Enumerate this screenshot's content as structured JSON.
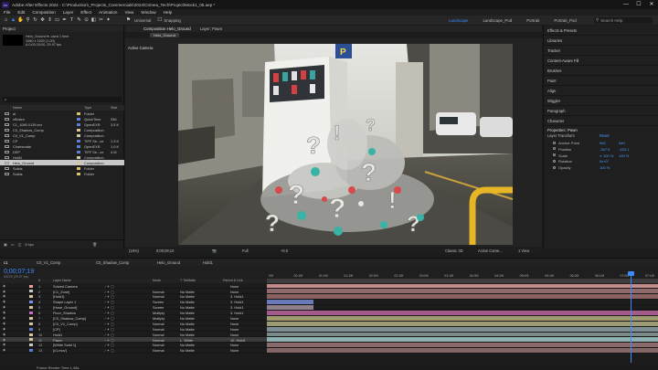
{
  "window": {
    "title": "Adobe After Effects 2024 - C:\\Production\\_Projects_Commercials\\2024\\Crimea_Tech\\Project\\Mock1_05.aep *",
    "app_icon": "Ae",
    "controls": [
      "—",
      "☐",
      "✕"
    ]
  },
  "menu": [
    "File",
    "Edit",
    "Composition",
    "Layer",
    "Effect",
    "Animation",
    "View",
    "Window",
    "Help"
  ],
  "toolbar": {
    "tools": [
      "home-icon",
      "selection-tool-icon",
      "hand-tool-icon",
      "zoom-tool-icon",
      "orbit-tool-icon",
      "pan-tool-icon",
      "dolly-tool-icon",
      "rect-tool-icon",
      "pen-tool-icon",
      "type-tool-icon",
      "brush-tool-icon",
      "clone-tool-icon",
      "eraser-tool-icon",
      "roto-tool-icon",
      "puppet-tool-icon"
    ],
    "snapping_label": "Snapping",
    "universal_label": "Universal",
    "workspaces": [
      "Landscape",
      "Landscape_Pod",
      "Portrait",
      "Portrait_Pod"
    ],
    "active_workspace": "Landscape",
    "search_placeholder": "Search Help"
  },
  "project": {
    "panel_title": "Project",
    "thumb_name": "Helo_Ground",
    "thumb_info": [
      "Helo_Ground ▾, used 1 time",
      "1080 x 1920 (1.00)",
      "Δ 0;00;10;00, 29.97 fps"
    ],
    "search_placeholder": "ρ",
    "columns": [
      "Name",
      "Type",
      "Size"
    ],
    "items": [
      {
        "name": "ai",
        "type": "Folder",
        "size": "",
        "label": "#d8c46a"
      },
      {
        "name": "cBoken",
        "type": "QuickTime",
        "size": "336",
        "label": "#5c7fd1"
      },
      {
        "name": "C1_1080.0139.exr",
        "type": "OpenEXR",
        "size": "3.5 K",
        "label": "#5c7fd1"
      },
      {
        "name": "C0_Shadow_Comp",
        "type": "Composition",
        "size": "",
        "label": "#d3c6a0"
      },
      {
        "name": "C0_V1_Comp",
        "type": "Composition",
        "size": "",
        "label": "#d3c6a0"
      },
      {
        "name": "CP",
        "type": "TIFF Se...ce",
        "size": "1.3 K",
        "label": "#5c7fd1"
      },
      {
        "name": "Chartsmate",
        "type": "OpenEXR",
        "size": "1.0 K",
        "label": "#5c7fd1"
      },
      {
        "name": "DEP",
        "type": "TIFF Se...ce",
        "size": "4 M",
        "label": "#5c7fd1"
      },
      {
        "name": "Hold1",
        "type": "Composition",
        "size": "",
        "label": "#d3c6a0"
      },
      {
        "name": "Helo_Ground",
        "type": "Composition",
        "size": "",
        "label": "#d3c6a0",
        "selected": true
      },
      {
        "name": "Solids",
        "type": "Folder",
        "size": "",
        "label": "#d8c46a"
      },
      {
        "name": "Solids",
        "type": "Folder",
        "size": "",
        "label": "#d8c46a"
      }
    ],
    "footer": "8 bpc"
  },
  "viewer": {
    "tabs": [
      "Composition Helo_Ground",
      "Layer: Pawn"
    ],
    "crumb": "Helo_Ground",
    "camera_label": "Active Camera",
    "footer": {
      "zoom": "(19%)",
      "timecode": "0;00;09;10",
      "res": "Full",
      "renderer": "Classic 3D",
      "view": "Active Came...",
      "views": "1 View",
      "exposure": "+0.0"
    }
  },
  "right_panel": {
    "tabs": [
      "Effects & Presets",
      "Libraries",
      "Tracker",
      "Content-Aware Fill",
      "Brushes",
      "Paint",
      "Align",
      "Wiggler",
      "Paragraph",
      "Character"
    ],
    "properties": {
      "title": "Properties: Pawn",
      "section": "Layer Transform",
      "reset": "Reset",
      "rows": [
        {
          "label": "Anchor Point",
          "v1": "960",
          "v2": "540"
        },
        {
          "label": "Position",
          "v1": "-347.5",
          "v2": "-153.1"
        },
        {
          "label": "Scale",
          "v1": "∞ 100 %",
          "v2": "100 %"
        },
        {
          "label": "Rotation",
          "v1": "0x+0°",
          "v2": ""
        },
        {
          "label": "Opacity",
          "v1": "100 %",
          "v2": ""
        }
      ]
    }
  },
  "timeline": {
    "tabs": [
      "c1",
      "C0_V1_Comp",
      "C0_Shadow_Comp",
      "Helo_Ground",
      "Hold1"
    ],
    "timecode": "0;00;07;19",
    "sub_timecode": "00229 (29.97 fps)",
    "columns": [
      "#",
      "Layer Name",
      "Mode",
      "T TrkMatte",
      "Parent & Link"
    ],
    "ruler": [
      "00f",
      "00:15f",
      "01:00f",
      "01:15f",
      "02:00f",
      "02:15f",
      "03:00f",
      "03:15f",
      "04:00f",
      "04:15f",
      "05:00f",
      "05:15f",
      "06:00f",
      "06:15f",
      "07:00f",
      "07:15f"
    ],
    "layers": [
      {
        "num": "1",
        "name": "Solved Camera",
        "mode": "",
        "trk": "",
        "parent": "None",
        "label": "#e8a0a0",
        "bar": "#c28a8a",
        "start": 0,
        "end": 100
      },
      {
        "num": "2",
        "name": "[C1_Zone]",
        "mode": "Normal",
        "trk": "No Matte",
        "parent": "None",
        "label": "#c8c8c8",
        "bar": "#8f6a6a",
        "start": 0,
        "end": 100
      },
      {
        "num": "3",
        "name": "[Hold1]",
        "mode": "Normal",
        "trk": "No Matte",
        "parent": "3. Hold1",
        "label": "#d3c6a0",
        "bar": "#8a6060",
        "start": 0,
        "end": 100
      },
      {
        "num": "4",
        "name": "Shape Layer 1",
        "mode": "Screen",
        "trk": "No Matte",
        "parent": "3. Hold1",
        "label": "#7d8fe0",
        "bar": "#6a7ab8",
        "start": 0,
        "end": 12
      },
      {
        "num": "5",
        "name": "[Hose_Ground]",
        "mode": "Screen",
        "trk": "No Matte",
        "parent": "3. Hold1",
        "label": "#d3c6a0",
        "bar": "#8f7f88",
        "start": 0,
        "end": 12
      },
      {
        "num": "6",
        "name": "Floor_Shadow",
        "mode": "Multiply",
        "trk": "No Matte",
        "parent": "3. Hold1",
        "label": "#c86ec8",
        "bar": "#a45a8a",
        "start": 0,
        "end": 100
      },
      {
        "num": "7",
        "name": "[C0_Shadow_Comp]",
        "mode": "Multiply",
        "trk": "No Matte",
        "parent": "None",
        "label": "#d3c6a0",
        "bar": "#a09a70",
        "start": 0,
        "end": 100
      },
      {
        "num": "8",
        "name": "[C0_V1_Comp]",
        "mode": "Normal",
        "trk": "No Matte",
        "parent": "None",
        "label": "#d3c6a0",
        "bar": "#9b9b75",
        "start": 0,
        "end": 100
      },
      {
        "num": "9",
        "name": "[CP]",
        "mode": "Normal",
        "trk": "No Matte",
        "parent": "None",
        "label": "#5c7fd1",
        "bar": "#7e8f93",
        "start": 0,
        "end": 100
      },
      {
        "num": "10",
        "name": "Hold1",
        "mode": "Normal",
        "trk": "No Matte",
        "parent": "None",
        "label": "#d3c6a0",
        "bar": "#7a8b8a",
        "start": 0,
        "end": 100
      },
      {
        "num": "11",
        "name": "Pawn",
        "mode": "Normal",
        "trk": "L. White",
        "parent": "10. Hold1",
        "label": "#d3c6a0",
        "bar": "#8fb0b0",
        "start": 0,
        "end": 100,
        "selected": true
      },
      {
        "num": "12",
        "name": "[White Solid 1]",
        "mode": "Normal",
        "trk": "No Matte",
        "parent": "None",
        "label": "#c8c8c8",
        "bar": "#8a6a6a",
        "start": 0,
        "end": 100
      },
      {
        "num": "13",
        "name": "[c1.mov]",
        "mode": "Normal",
        "trk": "No Matte",
        "parent": "None",
        "label": "#5c7fd1",
        "bar": "#856666",
        "start": 0,
        "end": 100
      }
    ],
    "footer": "Frame Render Time  1.48s",
    "playhead_fraction": 0.93
  },
  "colors": {
    "accent": "#3c8cff",
    "panel": "#1f1f1f",
    "selected_row": "#c8c8c8"
  }
}
